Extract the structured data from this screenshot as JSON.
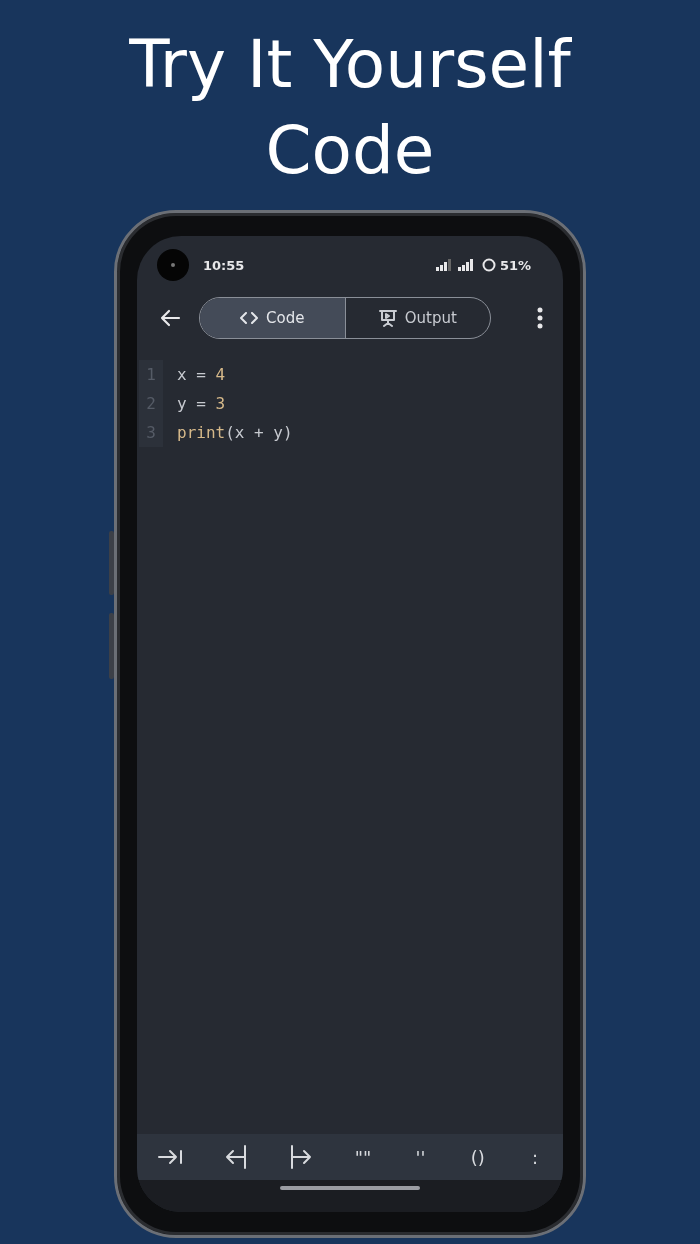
{
  "headline": [
    "Try It Yourself",
    "Code"
  ],
  "status_bar": {
    "time": "10:55",
    "battery": "51%"
  },
  "tabs": [
    {
      "label": "Code",
      "kind": "code",
      "selected": true
    },
    {
      "label": "Output",
      "kind": "output",
      "selected": false
    }
  ],
  "editor": {
    "lines": [
      {
        "number": "1",
        "tokens": [
          {
            "text": "x = ",
            "kind": "plain"
          },
          {
            "text": "4",
            "kind": "number"
          }
        ]
      },
      {
        "number": "2",
        "tokens": [
          {
            "text": "y = ",
            "kind": "plain"
          },
          {
            "text": "3",
            "kind": "number"
          }
        ]
      },
      {
        "number": "3",
        "tokens": [
          {
            "text": "print",
            "kind": "builtin"
          },
          {
            "text": "(x + y)",
            "kind": "plain"
          }
        ]
      }
    ]
  },
  "keys": [
    {
      "kind": "tab"
    },
    {
      "kind": "unindent"
    },
    {
      "kind": "indent"
    },
    {
      "kind": "text",
      "label": "\"\""
    },
    {
      "kind": "text",
      "label": "''"
    },
    {
      "kind": "text",
      "label": "()"
    },
    {
      "kind": "text",
      "label": ":"
    }
  ]
}
